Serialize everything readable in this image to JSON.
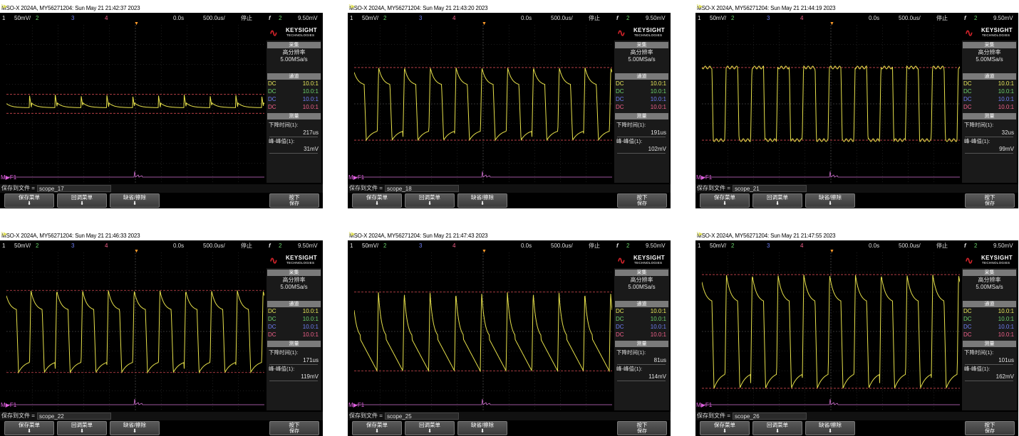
{
  "panels": [
    {
      "title": "MSO-X 2024A, MY56271204: Sun May 21 21:42:37 2023",
      "status": {
        "ch1": "1",
        "ch1_scale": "50mV/",
        "ch2": "2",
        "ch3": "3",
        "ch4": "4",
        "time_pos": "0.0s",
        "time_scale": "500.0us/",
        "run_state": "停止",
        "trig_icon": "f",
        "trig_src": "2",
        "trig_level": "9.50mV"
      },
      "save_file_label": "保存到文件 =",
      "save_file_name": "scope_17",
      "measure": {
        "fall_time": "217us",
        "pk_pk": "31mV"
      },
      "wave": {
        "type": "ripple",
        "amp": 0.12
      }
    },
    {
      "title": "MSO-X 2024A, MY56271204: Sun May 21 21:43:20 2023",
      "status": {
        "ch1": "1",
        "ch1_scale": "50mV/",
        "ch2": "2",
        "ch3": "3",
        "ch4": "4",
        "time_pos": "0.0s",
        "time_scale": "500.0us/",
        "run_state": "停止",
        "trig_icon": "f",
        "trig_src": "2",
        "trig_level": "9.50mV"
      },
      "save_file_label": "保存到文件 =",
      "save_file_name": "scope_18",
      "measure": {
        "fall_time": "191us",
        "pk_pk": "102mV"
      },
      "wave": {
        "type": "decay",
        "amp": 0.46
      }
    },
    {
      "title": "MSO-X 2024A, MY56271204: Sun May 21 21:44:19 2023",
      "status": {
        "ch1": "1",
        "ch1_scale": "50mV/",
        "ch2": "2",
        "ch3": "3",
        "ch4": "4",
        "time_pos": "0.0s",
        "time_scale": "500.0us/",
        "run_state": "停止",
        "trig_icon": "f",
        "trig_src": "2",
        "trig_level": "9.50mV"
      },
      "save_file_label": "保存到文件 =",
      "save_file_name": "scope_21",
      "measure": {
        "fall_time": "32us",
        "pk_pk": "99mV"
      },
      "wave": {
        "type": "square",
        "amp": 0.46
      }
    },
    {
      "title": "MSO-X 2024A, MY56271204: Sun May 21 21:46:33 2023",
      "status": {
        "ch1": "1",
        "ch1_scale": "50mV/",
        "ch2": "2",
        "ch3": "3",
        "ch4": "4",
        "time_pos": "0.0s",
        "time_scale": "500.0us/",
        "run_state": "停止",
        "trig_icon": "f",
        "trig_src": "2",
        "trig_level": "9.50mV"
      },
      "save_file_label": "保存到文件 =",
      "save_file_name": "scope_22",
      "measure": {
        "fall_time": "171us",
        "pk_pk": "119mV"
      },
      "wave": {
        "type": "decay",
        "amp": 0.52
      }
    },
    {
      "title": "MSO-X 2024A, MY56271204: Sun May 21 21:47:43 2023",
      "status": {
        "ch1": "1",
        "ch1_scale": "50mV/",
        "ch2": "2",
        "ch3": "3",
        "ch4": "4",
        "time_pos": "0.0s",
        "time_scale": "500.0us/",
        "run_state": "停止",
        "trig_icon": "f",
        "trig_src": "2",
        "trig_level": "9.50mV"
      },
      "save_file_label": "保存到文件 =",
      "save_file_name": "scope_25",
      "measure": {
        "fall_time": "81us",
        "pk_pk": "114mV"
      },
      "wave": {
        "type": "sawrise",
        "amp": 0.5
      }
    },
    {
      "title": "MSO-X 2024A, MY56271204: Sun May 21 21:47:55 2023",
      "status": {
        "ch1": "1",
        "ch1_scale": "50mV/",
        "ch2": "2",
        "ch3": "3",
        "ch4": "4",
        "time_pos": "0.0s",
        "time_scale": "500.0us/",
        "run_state": "停止",
        "trig_icon": "f",
        "trig_src": "2",
        "trig_level": "9.50mV"
      },
      "save_file_label": "保存到文件 =",
      "save_file_name": "scope_26",
      "measure": {
        "fall_time": "101us",
        "pk_pk": "162mV"
      },
      "wave": {
        "type": "decay",
        "amp": 0.72
      }
    }
  ],
  "side": {
    "brand": "KEYSIGHT",
    "brand_sub": "TECHNOLOGIES",
    "acq_header": "采集",
    "acq_mode": "高分辨率",
    "sample_rate": "5.00MSa/s",
    "chan_header": "通道",
    "channels": [
      {
        "coupling": "DC",
        "probe": "10.0:1",
        "color": "#e8e85a"
      },
      {
        "coupling": "DC",
        "probe": "10.0:1",
        "color": "#6cd36c"
      },
      {
        "coupling": "DC",
        "probe": "10.0:1",
        "color": "#6f7ff5"
      },
      {
        "coupling": "DC",
        "probe": "10.0:1",
        "color": "#f0608a"
      }
    ],
    "meas_header": "测量",
    "fall_label": "下降时间(1):",
    "pkpk_label": "峰-峰值(1):"
  },
  "softkeys": {
    "save_menu": "保存菜单",
    "recall_menu": "回调菜单",
    "default_erase": "缺省/擦除",
    "press_label": "按下",
    "press_save": "保存"
  },
  "markers": {
    "ch1": "1",
    "math": "M",
    "f1": "F1"
  },
  "colors": {
    "trace": "#e6e04a",
    "cursor": "#d0484f",
    "fft": "#d070d0",
    "grid": "#3a3a3a"
  }
}
